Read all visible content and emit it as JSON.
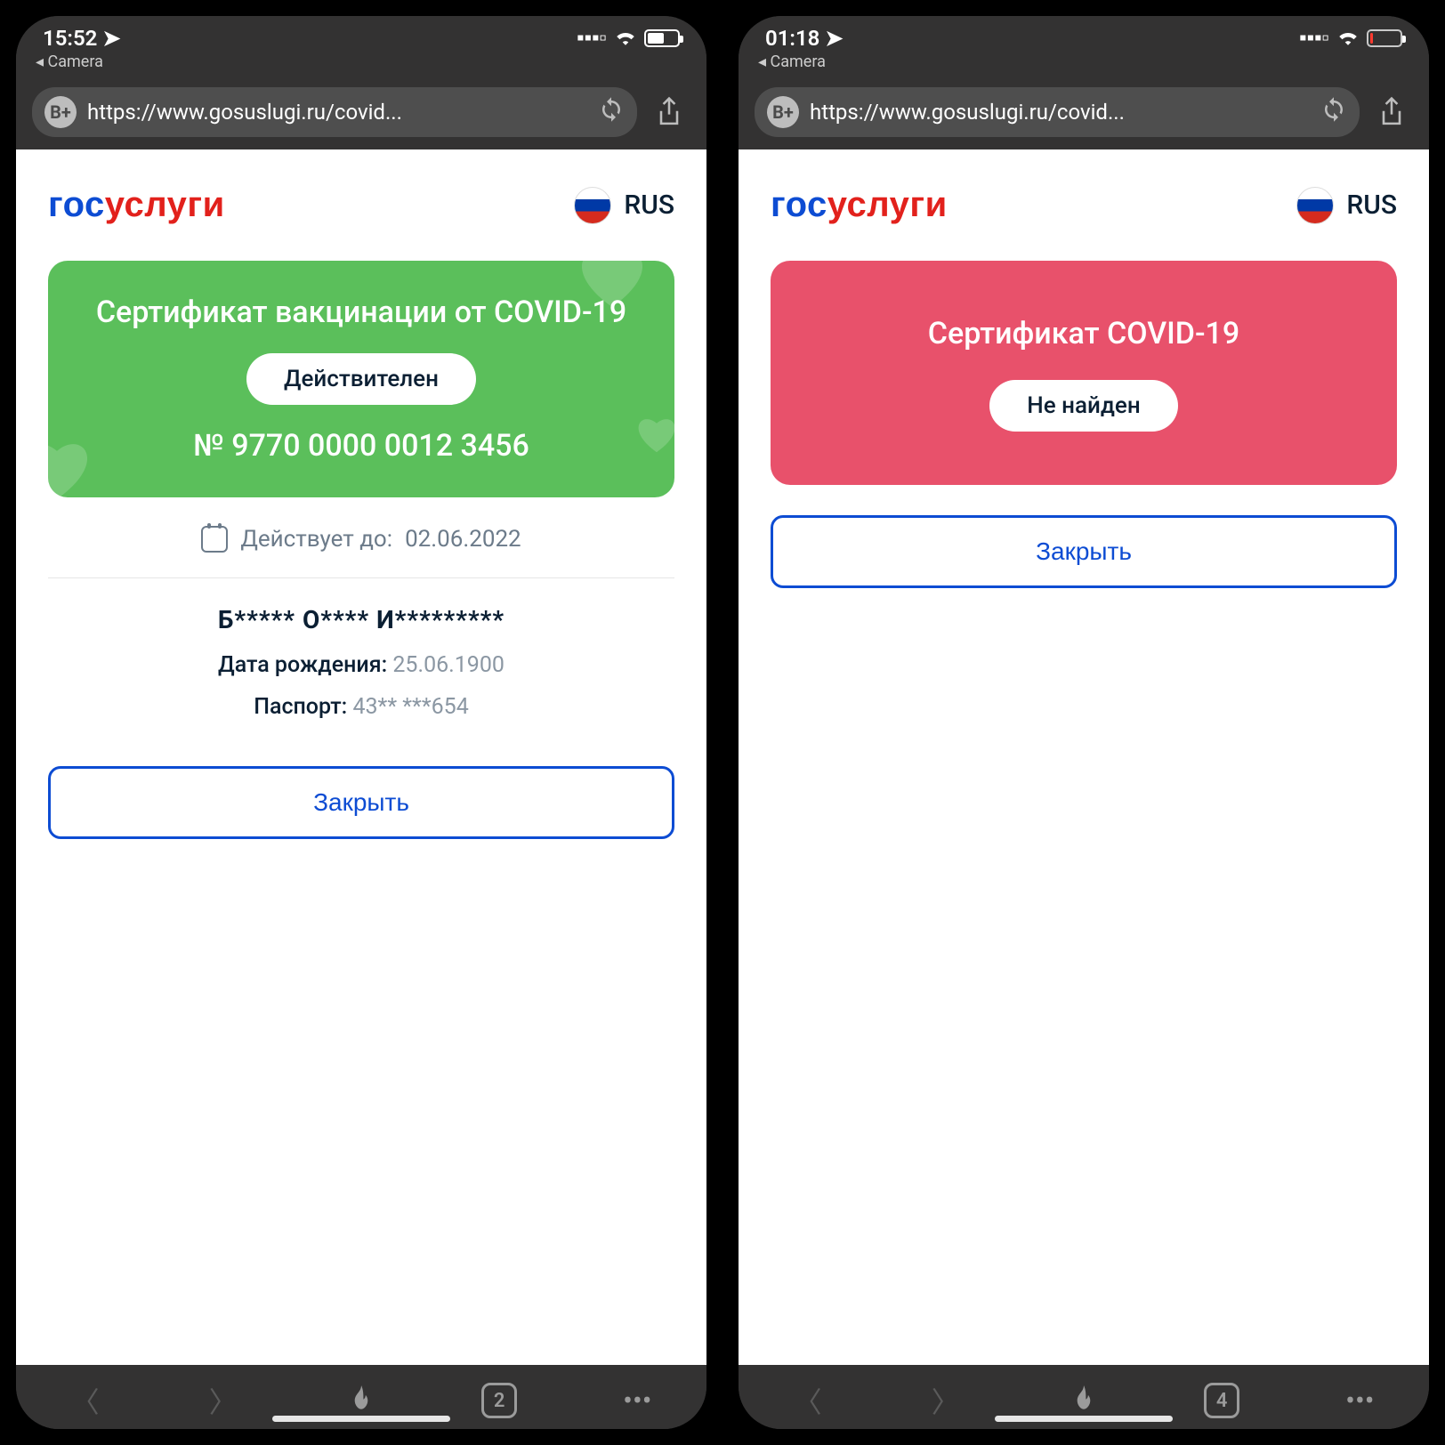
{
  "left": {
    "status": {
      "time": "15:52",
      "back_app": "◂ Camera",
      "battery_pct": 55
    },
    "address": {
      "badge": "B+",
      "url": "https://www.gosuslugi.ru/covid..."
    },
    "logo": {
      "part1": "гос",
      "part2": "услуги"
    },
    "lang": "RUS",
    "card": {
      "title": "Сертификат вакцинации от COVID-19",
      "status_pill": "Действителен",
      "cert_no": "№ 9770 0000 0012 3456"
    },
    "valid_until_label": "Действует до:",
    "valid_until_value": "02.06.2022",
    "person": {
      "name_masked": "Б***** О**** И*********",
      "dob_label": "Дата рождения:",
      "dob_value": "25.06.1900",
      "passport_label": "Паспорт:",
      "passport_value": "43** ***654"
    },
    "close": "Закрыть",
    "tabs": "2"
  },
  "right": {
    "status": {
      "time": "01:18",
      "back_app": "◂ Camera",
      "battery_pct": 8
    },
    "address": {
      "badge": "B+",
      "url": "https://www.gosuslugi.ru/covid..."
    },
    "logo": {
      "part1": "гос",
      "part2": "услуги"
    },
    "lang": "RUS",
    "card": {
      "title": "Сертификат COVID-19",
      "status_pill": "Не найден"
    },
    "close": "Закрыть",
    "tabs": "4"
  }
}
